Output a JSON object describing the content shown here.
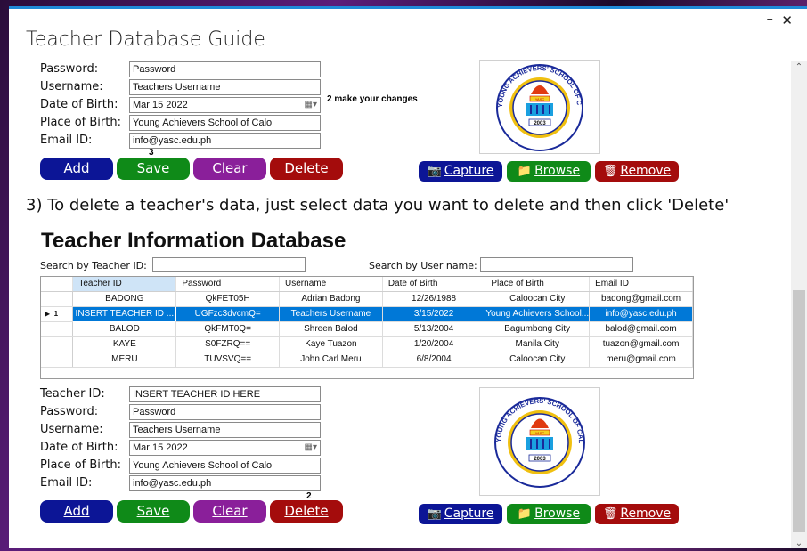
{
  "window": {
    "title": "Teacher Database Guide",
    "minimize_glyph": "–",
    "close_glyph": "✕"
  },
  "scroll": {
    "up_glyph": "⌃",
    "down_glyph": "⌄"
  },
  "top_form": {
    "password_label": "Password:",
    "password_value": "Password",
    "username_label": "Username:",
    "username_value": "Teachers Username",
    "dob_label": "Date of Birth:",
    "dob_value": "Mar  15 2022",
    "pob_label": "Place of Birth:",
    "pob_value": "Young Achievers School of Calo",
    "email_label": "Email ID:",
    "email_value": "info@yasc.edu.ph",
    "note_changes": "2 make your changes",
    "note_save": "3"
  },
  "buttons": {
    "add": "Add",
    "save": "Save",
    "clear": "Clear",
    "delete": "Delete",
    "capture": "Capture",
    "browse": "Browse",
    "remove": "Remove"
  },
  "instruction": "3) To delete a teacher's data, just select data you want to delete and then click 'Delete'",
  "database": {
    "title": "Teacher Information Database",
    "search_id_label": "Search by Teacher ID:",
    "search_user_label": "Search by User name:",
    "columns": [
      "Teacher ID",
      "Password",
      "Username",
      "Date of Birth",
      "Place of Birth",
      "Email ID"
    ],
    "rows": [
      [
        "BADONG",
        "QkFET05H",
        "Adrian Badong",
        "12/26/1988",
        "Caloocan City",
        "badong@gmail.com"
      ],
      [
        "INSERT TEACHER ID ...",
        "UGFzc3dvcmQ=",
        "Teachers Username",
        "3/15/2022",
        "Young Achievers School...",
        "info@yasc.edu.ph"
      ],
      [
        "BALOD",
        "QkFMT0Q=",
        "Shreen Balod",
        "5/13/2004",
        "Bagumbong City",
        "balod@gmail.com"
      ],
      [
        "KAYE",
        "S0FZRQ==",
        "Kaye Tuazon",
        "1/20/2004",
        "Manila City",
        "tuazon@gmail.com"
      ],
      [
        "MERU",
        "TUVSVQ==",
        "John Carl Meru",
        "6/8/2004",
        "Caloocan City",
        "meru@gmail.com"
      ]
    ],
    "selected_row_marker": "▶",
    "selected_row_number": "1"
  },
  "bottom_form": {
    "teacher_id_label": "Teacher ID:",
    "teacher_id_value": "INSERT TEACHER ID HERE",
    "password_label": "Password:",
    "password_value": "Password",
    "username_label": "Username:",
    "username_value": "Teachers Username",
    "dob_label": "Date of Birth:",
    "dob_value": "Mar  15 2022",
    "pob_label": "Place of Birth:",
    "pob_value": "Young Achievers School of Calo",
    "email_label": "Email ID:",
    "email_value": "info@yasc.edu.ph",
    "note_delete": "2"
  },
  "logo": {
    "ring_text": "YOUNG ACHIEVERS' SCHOOL OF CALOOCAN, INC.",
    "year": "2003",
    "badge": "YASC"
  },
  "colors": {
    "add": "#0c1596",
    "save": "#0f8a18",
    "clear": "#8a1f9a",
    "delete": "#a40c0c",
    "selected_row": "#0078d7",
    "title_bar_accent": "#1f8ad8"
  }
}
